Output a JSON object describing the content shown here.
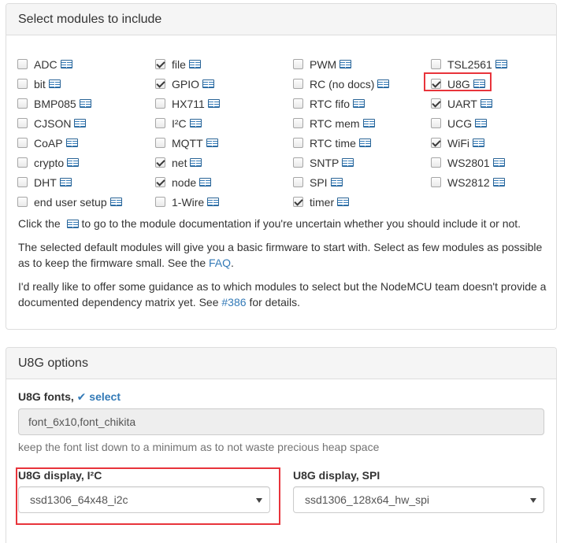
{
  "modules_panel": {
    "title": "Select modules to include",
    "columns": [
      [
        {
          "label": "ADC",
          "checked": false
        },
        {
          "label": "bit",
          "checked": false
        },
        {
          "label": "BMP085",
          "checked": false
        },
        {
          "label": "CJSON",
          "checked": false
        },
        {
          "label": "CoAP",
          "checked": false
        },
        {
          "label": "crypto",
          "checked": false
        },
        {
          "label": "DHT",
          "checked": false
        },
        {
          "label": "end user setup",
          "checked": false
        }
      ],
      [
        {
          "label": "file",
          "checked": true
        },
        {
          "label": "GPIO",
          "checked": true
        },
        {
          "label": "HX711",
          "checked": false
        },
        {
          "label": "I²C",
          "checked": false
        },
        {
          "label": "MQTT",
          "checked": false
        },
        {
          "label": "net",
          "checked": true
        },
        {
          "label": "node",
          "checked": true
        },
        {
          "label": "1-Wire",
          "checked": false
        }
      ],
      [
        {
          "label": "PWM",
          "checked": false
        },
        {
          "label": "RC (no docs)",
          "checked": false
        },
        {
          "label": "RTC fifo",
          "checked": false
        },
        {
          "label": "RTC mem",
          "checked": false
        },
        {
          "label": "RTC time",
          "checked": false
        },
        {
          "label": "SNTP",
          "checked": false
        },
        {
          "label": "SPI",
          "checked": false
        },
        {
          "label": "timer",
          "checked": true
        }
      ],
      [
        {
          "label": "TSL2561",
          "checked": false
        },
        {
          "label": "U8G",
          "checked": true
        },
        {
          "label": "UART",
          "checked": true
        },
        {
          "label": "UCG",
          "checked": false
        },
        {
          "label": "WiFi",
          "checked": true
        },
        {
          "label": "WS2801",
          "checked": false
        },
        {
          "label": "WS2812",
          "checked": false
        }
      ]
    ],
    "doc_hint_before": "Click the",
    "doc_hint_after": "to go to the module documentation if you're uncertain whether you should include it or not.",
    "defaults_text": "The selected default modules will give you a basic firmware to start with. Select as few modules as possible as to keep the firmware small. See the",
    "faq_link": "FAQ",
    "guidance_text": "I'd really like to offer some guidance as to which modules to select but the NodeMCU team doesn't provide a documented dependency matrix yet. See",
    "issue_link": "#386",
    "guidance_suffix": "for details."
  },
  "u8g_panel": {
    "title": "U8G options",
    "fonts_label": "U8G fonts,",
    "select_link": "select",
    "fonts_value": "font_6x10,font_chikita",
    "fonts_help": "keep the font list down to a minimum as to not waste precious heap space",
    "display_i2c_label": "U8G display, I²C",
    "display_i2c_value": "ssd1306_64x48_i2c",
    "display_spi_label": "U8G display, SPI",
    "display_spi_value": "ssd1306_128x64_hw_spi"
  },
  "colors": {
    "link": "#337ab7",
    "highlight": "#e8343b",
    "panel_heading_bg": "#f5f5f5"
  }
}
